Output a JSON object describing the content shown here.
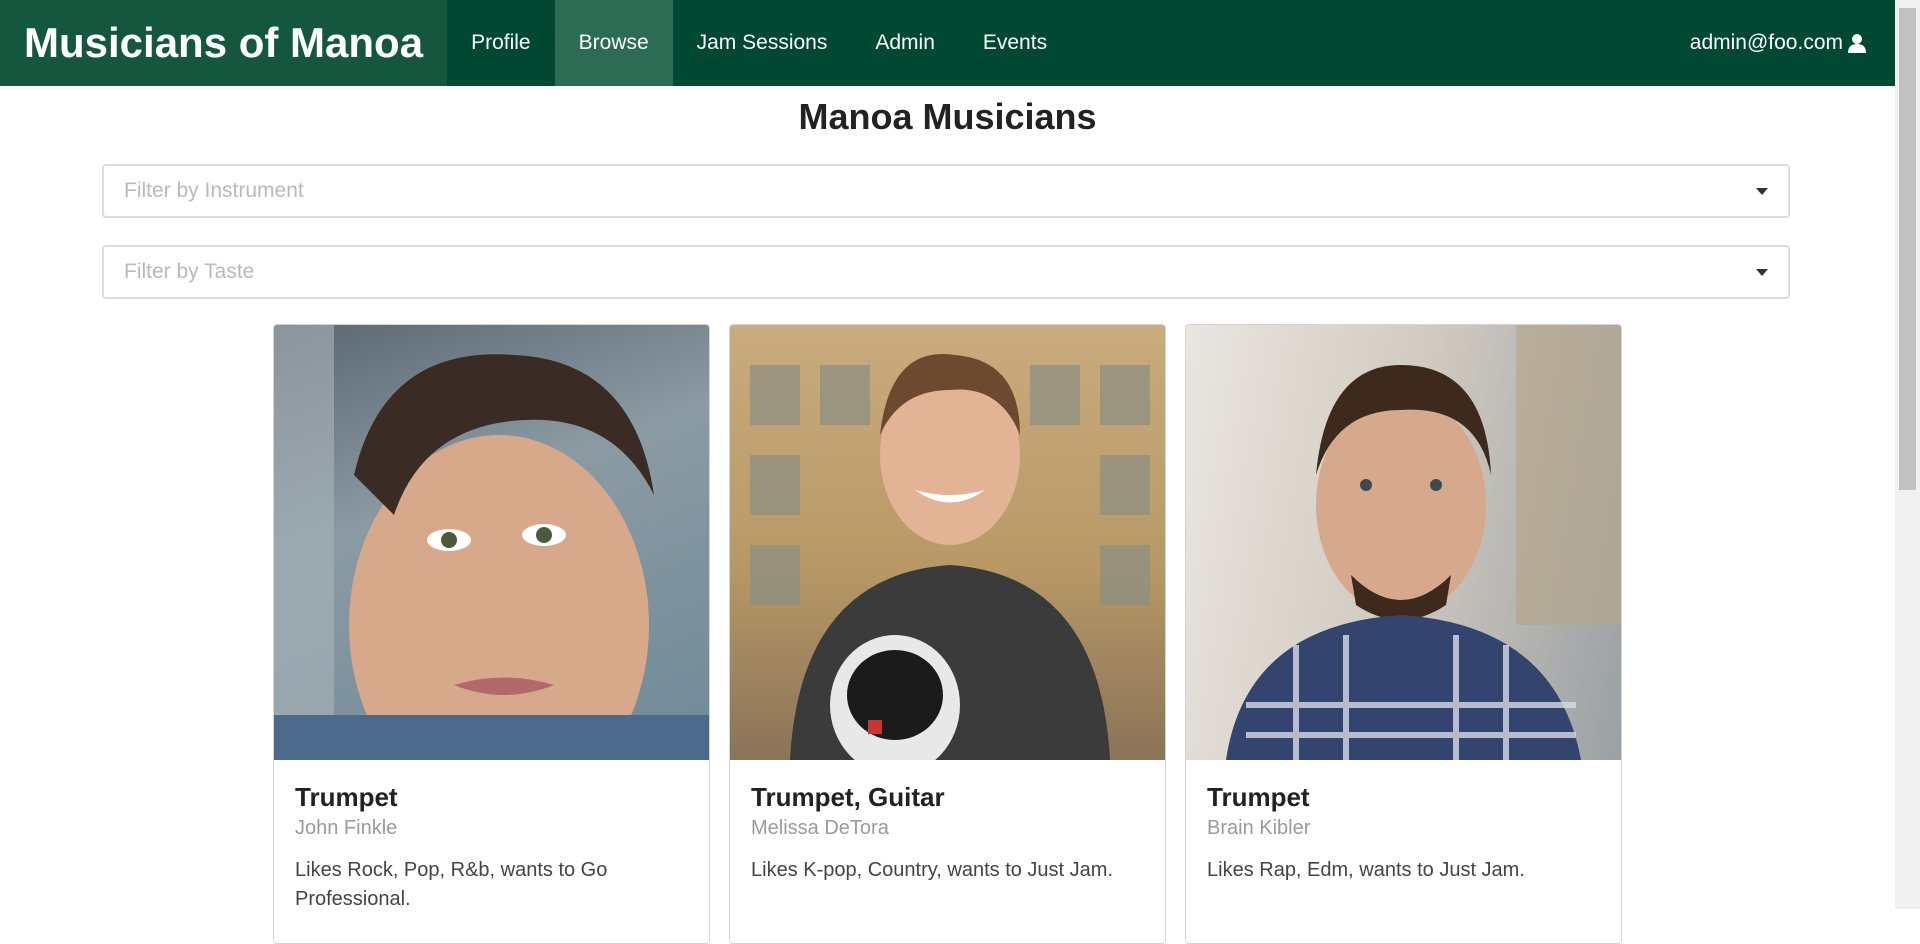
{
  "nav": {
    "brand": "Musicians of Manoa",
    "items": [
      {
        "label": "Profile",
        "active": false
      },
      {
        "label": "Browse",
        "active": true
      },
      {
        "label": "Jam Sessions",
        "active": false
      },
      {
        "label": "Admin",
        "active": false
      },
      {
        "label": "Events",
        "active": false
      }
    ],
    "user": "admin@foo.com",
    "user_icon": "user-icon",
    "color": "#004831"
  },
  "page": {
    "title": "Manoa Musicians"
  },
  "filters": {
    "instrument_placeholder": "Filter by Instrument",
    "taste_placeholder": "Filter by Taste"
  },
  "cards": [
    {
      "header": "Trumpet",
      "meta": "John Finkle",
      "description": "Likes Rock, Pop, R&b, wants to Go Professional."
    },
    {
      "header": "Trumpet, Guitar",
      "meta": "Melissa DeTora",
      "description": "Likes K-pop, Country, wants to Just Jam."
    },
    {
      "header": "Trumpet",
      "meta": "Brain Kibler",
      "description": "Likes Rap, Edm, wants to Just Jam."
    }
  ]
}
